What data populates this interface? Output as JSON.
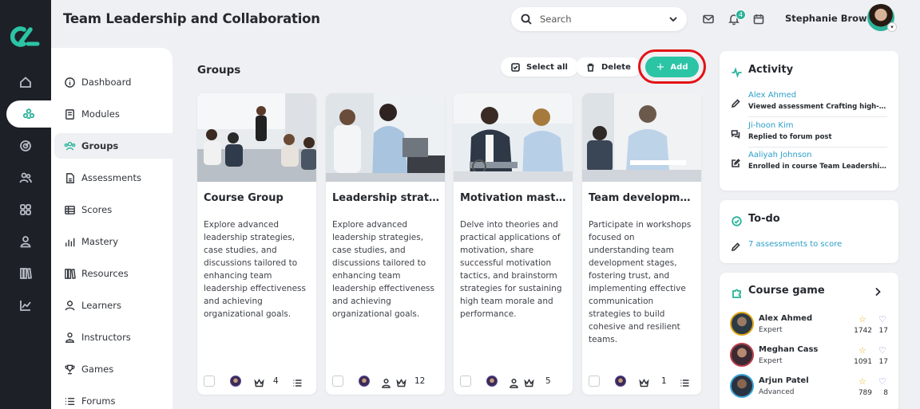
{
  "page": {
    "title": "Team Leadership and Collaboration"
  },
  "search": {
    "placeholder": "Search"
  },
  "notifications": {
    "count": "4"
  },
  "user": {
    "name": "Stephanie Brown"
  },
  "colors": {
    "accent": "#2bc4a5",
    "rail": "#1d2127",
    "link": "#2b9fc9",
    "highlight_ring": "#e31216"
  },
  "rail_icons": [
    "home-icon",
    "groups-icon",
    "target-icon",
    "users-icon",
    "grid-icon",
    "person-icon",
    "library-icon",
    "chart-icon"
  ],
  "nav": {
    "items": [
      {
        "label": "Dashboard",
        "icon": "info-icon"
      },
      {
        "label": "Modules",
        "icon": "book-icon"
      },
      {
        "label": "Groups",
        "icon": "groups-icon",
        "active": true
      },
      {
        "label": "Assessments",
        "icon": "document-icon"
      },
      {
        "label": "Scores",
        "icon": "table-icon"
      },
      {
        "label": "Mastery",
        "icon": "bar-chart-icon"
      },
      {
        "label": "Resources",
        "icon": "library-icon"
      },
      {
        "label": "Learners",
        "icon": "learner-icon"
      },
      {
        "label": "Instructors",
        "icon": "instructor-icon"
      },
      {
        "label": "Games",
        "icon": "trophy-icon"
      },
      {
        "label": "Forums",
        "icon": "list-icon"
      }
    ]
  },
  "groups": {
    "title": "Groups",
    "select_all_label": "Select all",
    "delete_label": "Delete",
    "add_label": "Add",
    "cards": [
      {
        "title": "Course Group",
        "description": "Explore advanced leadership strategies, case studies, and discussions tailored to enhancing team leadership effectiveness and achieving organizational goals.",
        "count": "4"
      },
      {
        "title": "Leadership strate…",
        "description": "Explore advanced leadership strategies, case studies, and discussions tailored to enhancing team leadership effectiveness and achieving organizational goals.",
        "count": "12"
      },
      {
        "title": "Motivation master…",
        "description": "Delve into theories and practical applications of motivation, share successful motivation tactics, and brainstorm strategies for sustaining high team morale and performance.",
        "count": "5"
      },
      {
        "title": "Team developme…",
        "description": "Participate in workshops focused on understanding team development stages, fostering trust, and implementing effective communication strategies to build cohesive and resilient teams.",
        "count": "1"
      }
    ]
  },
  "activity": {
    "title": "Activity",
    "items": [
      {
        "who": "Alex Ahmed",
        "what": "Viewed assessment Crafting high-p…",
        "icon": "pencil-icon"
      },
      {
        "who": "Ji-hoon Kim",
        "what": "Replied to forum post",
        "icon": "chat-icon"
      },
      {
        "who": "Aaliyah Johnson",
        "what": "Enrolled in course Team Leadership …",
        "icon": "edit-icon"
      }
    ]
  },
  "todo": {
    "title": "To-do",
    "item": "7 assessments to score"
  },
  "course_game": {
    "title": "Course game",
    "players": [
      {
        "name": "Alex Ahmed",
        "level": "Expert",
        "points": "1742",
        "lives": "17"
      },
      {
        "name": "Meghan Cass",
        "level": "Expert",
        "points": "1091",
        "lives": "17"
      },
      {
        "name": "Arjun Patel",
        "level": "Advanced",
        "points": "789",
        "lives": "8"
      }
    ]
  }
}
